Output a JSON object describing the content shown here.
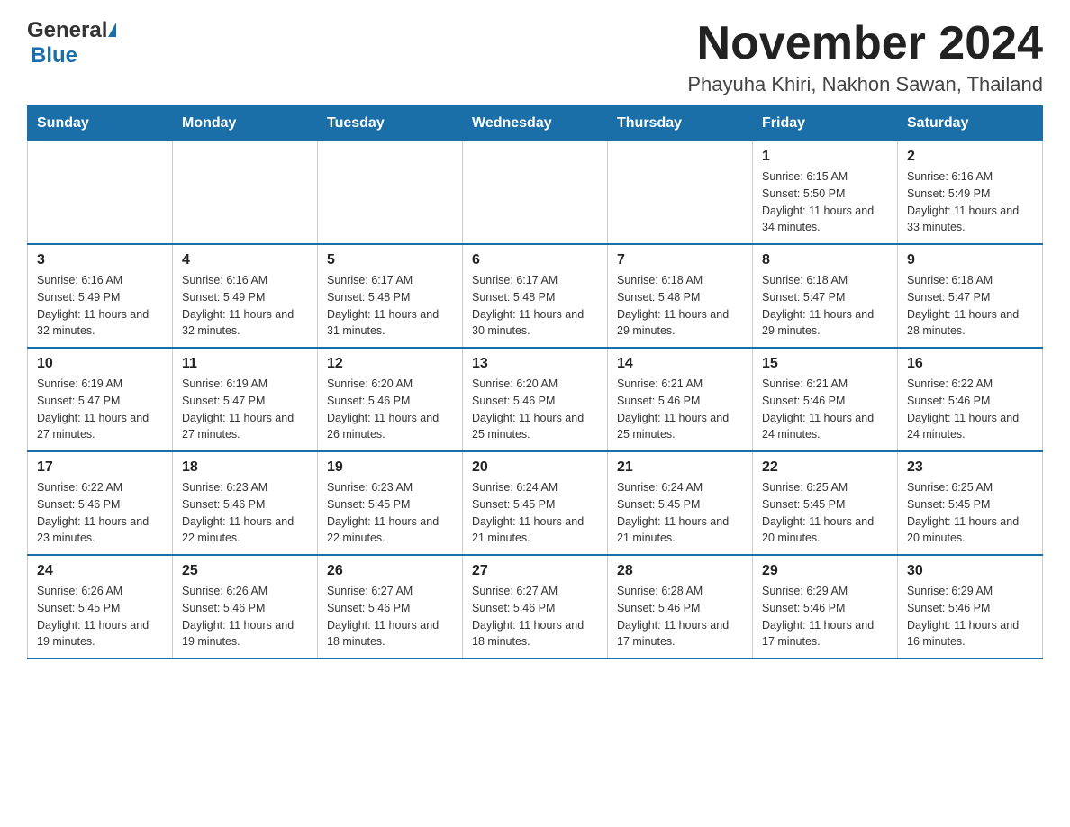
{
  "header": {
    "logo": {
      "general": "General",
      "blue": "Blue"
    },
    "title": "November 2024",
    "location": "Phayuha Khiri, Nakhon Sawan, Thailand"
  },
  "calendar": {
    "weekdays": [
      "Sunday",
      "Monday",
      "Tuesday",
      "Wednesday",
      "Thursday",
      "Friday",
      "Saturday"
    ],
    "weeks": [
      [
        {
          "day": "",
          "info": ""
        },
        {
          "day": "",
          "info": ""
        },
        {
          "day": "",
          "info": ""
        },
        {
          "day": "",
          "info": ""
        },
        {
          "day": "",
          "info": ""
        },
        {
          "day": "1",
          "info": "Sunrise: 6:15 AM\nSunset: 5:50 PM\nDaylight: 11 hours and 34 minutes."
        },
        {
          "day": "2",
          "info": "Sunrise: 6:16 AM\nSunset: 5:49 PM\nDaylight: 11 hours and 33 minutes."
        }
      ],
      [
        {
          "day": "3",
          "info": "Sunrise: 6:16 AM\nSunset: 5:49 PM\nDaylight: 11 hours and 32 minutes."
        },
        {
          "day": "4",
          "info": "Sunrise: 6:16 AM\nSunset: 5:49 PM\nDaylight: 11 hours and 32 minutes."
        },
        {
          "day": "5",
          "info": "Sunrise: 6:17 AM\nSunset: 5:48 PM\nDaylight: 11 hours and 31 minutes."
        },
        {
          "day": "6",
          "info": "Sunrise: 6:17 AM\nSunset: 5:48 PM\nDaylight: 11 hours and 30 minutes."
        },
        {
          "day": "7",
          "info": "Sunrise: 6:18 AM\nSunset: 5:48 PM\nDaylight: 11 hours and 29 minutes."
        },
        {
          "day": "8",
          "info": "Sunrise: 6:18 AM\nSunset: 5:47 PM\nDaylight: 11 hours and 29 minutes."
        },
        {
          "day": "9",
          "info": "Sunrise: 6:18 AM\nSunset: 5:47 PM\nDaylight: 11 hours and 28 minutes."
        }
      ],
      [
        {
          "day": "10",
          "info": "Sunrise: 6:19 AM\nSunset: 5:47 PM\nDaylight: 11 hours and 27 minutes."
        },
        {
          "day": "11",
          "info": "Sunrise: 6:19 AM\nSunset: 5:47 PM\nDaylight: 11 hours and 27 minutes."
        },
        {
          "day": "12",
          "info": "Sunrise: 6:20 AM\nSunset: 5:46 PM\nDaylight: 11 hours and 26 minutes."
        },
        {
          "day": "13",
          "info": "Sunrise: 6:20 AM\nSunset: 5:46 PM\nDaylight: 11 hours and 25 minutes."
        },
        {
          "day": "14",
          "info": "Sunrise: 6:21 AM\nSunset: 5:46 PM\nDaylight: 11 hours and 25 minutes."
        },
        {
          "day": "15",
          "info": "Sunrise: 6:21 AM\nSunset: 5:46 PM\nDaylight: 11 hours and 24 minutes."
        },
        {
          "day": "16",
          "info": "Sunrise: 6:22 AM\nSunset: 5:46 PM\nDaylight: 11 hours and 24 minutes."
        }
      ],
      [
        {
          "day": "17",
          "info": "Sunrise: 6:22 AM\nSunset: 5:46 PM\nDaylight: 11 hours and 23 minutes."
        },
        {
          "day": "18",
          "info": "Sunrise: 6:23 AM\nSunset: 5:46 PM\nDaylight: 11 hours and 22 minutes."
        },
        {
          "day": "19",
          "info": "Sunrise: 6:23 AM\nSunset: 5:45 PM\nDaylight: 11 hours and 22 minutes."
        },
        {
          "day": "20",
          "info": "Sunrise: 6:24 AM\nSunset: 5:45 PM\nDaylight: 11 hours and 21 minutes."
        },
        {
          "day": "21",
          "info": "Sunrise: 6:24 AM\nSunset: 5:45 PM\nDaylight: 11 hours and 21 minutes."
        },
        {
          "day": "22",
          "info": "Sunrise: 6:25 AM\nSunset: 5:45 PM\nDaylight: 11 hours and 20 minutes."
        },
        {
          "day": "23",
          "info": "Sunrise: 6:25 AM\nSunset: 5:45 PM\nDaylight: 11 hours and 20 minutes."
        }
      ],
      [
        {
          "day": "24",
          "info": "Sunrise: 6:26 AM\nSunset: 5:45 PM\nDaylight: 11 hours and 19 minutes."
        },
        {
          "day": "25",
          "info": "Sunrise: 6:26 AM\nSunset: 5:46 PM\nDaylight: 11 hours and 19 minutes."
        },
        {
          "day": "26",
          "info": "Sunrise: 6:27 AM\nSunset: 5:46 PM\nDaylight: 11 hours and 18 minutes."
        },
        {
          "day": "27",
          "info": "Sunrise: 6:27 AM\nSunset: 5:46 PM\nDaylight: 11 hours and 18 minutes."
        },
        {
          "day": "28",
          "info": "Sunrise: 6:28 AM\nSunset: 5:46 PM\nDaylight: 11 hours and 17 minutes."
        },
        {
          "day": "29",
          "info": "Sunrise: 6:29 AM\nSunset: 5:46 PM\nDaylight: 11 hours and 17 minutes."
        },
        {
          "day": "30",
          "info": "Sunrise: 6:29 AM\nSunset: 5:46 PM\nDaylight: 11 hours and 16 minutes."
        }
      ]
    ]
  }
}
